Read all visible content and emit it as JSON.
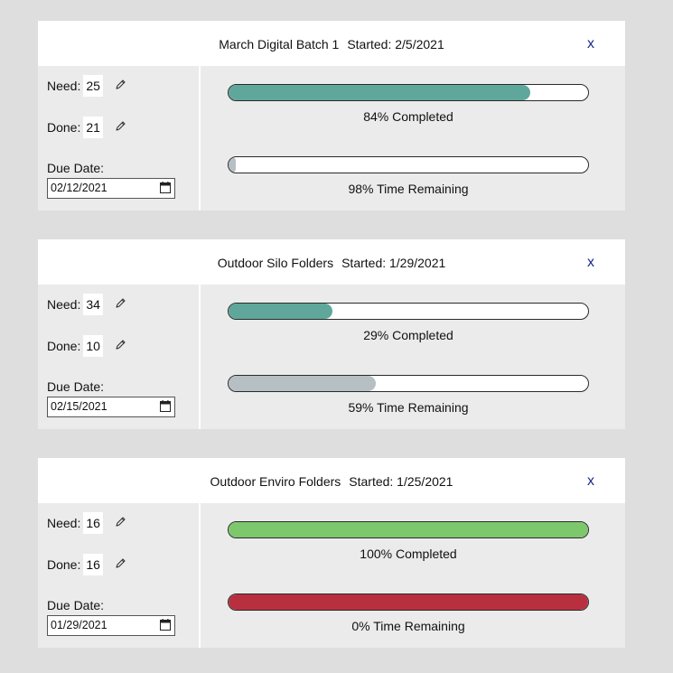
{
  "cards": [
    {
      "name": "March Digital Batch 1",
      "started": "Started: 2/5/2021",
      "close": "x",
      "need_label": "Need:",
      "need": "25",
      "done_label": "Done:",
      "done": "21",
      "due_label": "Due Date:",
      "due_date": "02/12/2021",
      "completed_text": "84% Completed",
      "completed_pct": 84,
      "completed_color": "#5fa79a",
      "time_text": "98% Time Remaining",
      "time_pct": 2,
      "time_color": "#b6bfc4"
    },
    {
      "name": "Outdoor Silo Folders",
      "started": "Started: 1/29/2021",
      "close": "x",
      "need_label": "Need:",
      "need": "34",
      "done_label": "Done:",
      "done": "10",
      "due_label": "Due Date:",
      "due_date": "02/15/2021",
      "completed_text": "29% Completed",
      "completed_pct": 29,
      "completed_color": "#5fa79a",
      "time_text": "59% Time Remaining",
      "time_pct": 41,
      "time_color": "#b6bfc4"
    },
    {
      "name": "Outdoor Enviro Folders",
      "started": "Started: 1/25/2021",
      "close": "x",
      "need_label": "Need:",
      "need": "16",
      "done_label": "Done:",
      "done": "16",
      "due_label": "Due Date:",
      "due_date": "01/29/2021",
      "completed_text": "100% Completed",
      "completed_pct": 100,
      "completed_color": "#7dc76c",
      "time_text": "0% Time Remaining",
      "time_pct": 100,
      "time_color": "#b8303f"
    }
  ],
  "icons": {
    "edit": "pencil-icon",
    "calendar": "calendar-icon"
  },
  "colors": {
    "background": "#dedede",
    "card": "#ebebeb",
    "header": "#ffffff",
    "close": "#1a2a8c"
  }
}
